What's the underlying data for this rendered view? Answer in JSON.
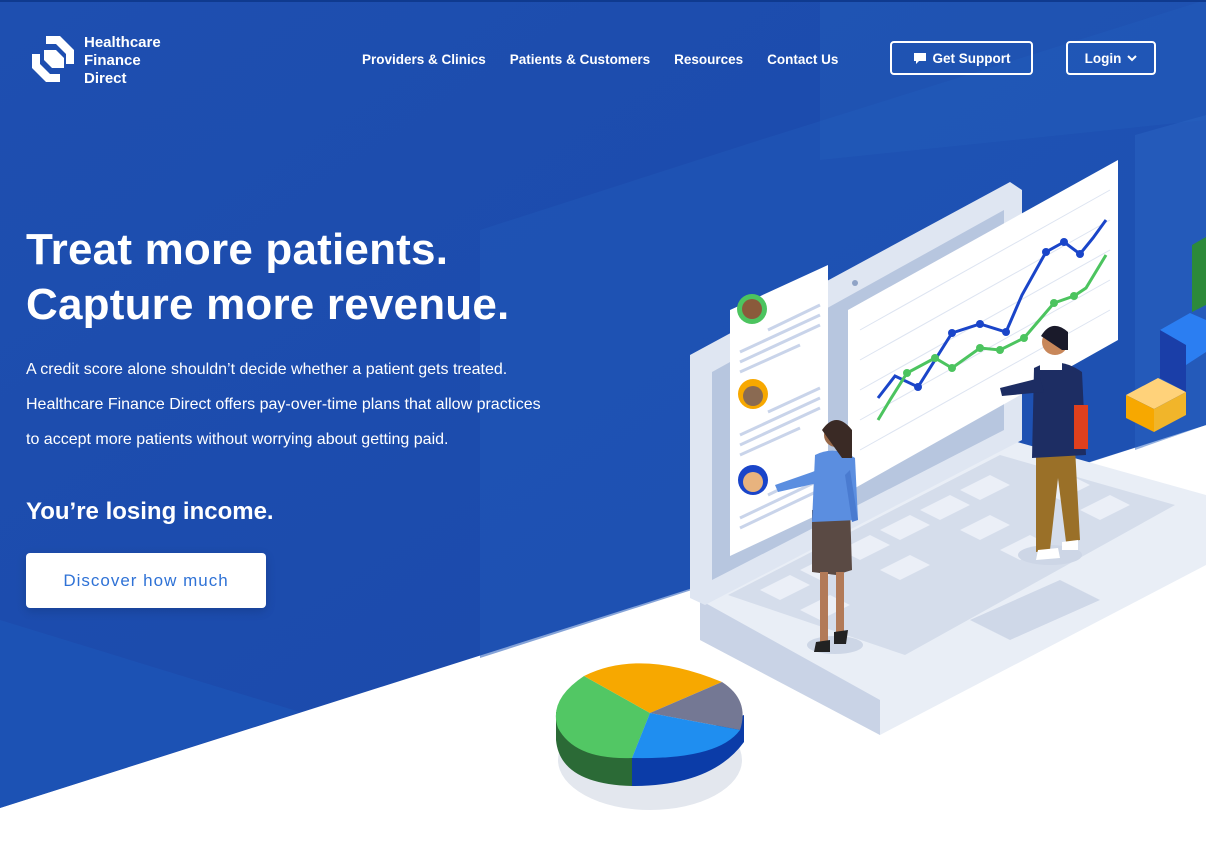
{
  "brand": {
    "name_line1": "Healthcare",
    "name_line2": "Finance",
    "name_line3": "Direct",
    "logo_icon": "hfd-logo-mark"
  },
  "nav": {
    "items": [
      {
        "label": "Providers & Clinics"
      },
      {
        "label": "Patients & Customers"
      },
      {
        "label": "Resources"
      },
      {
        "label": "Contact Us"
      }
    ],
    "support_label": "Get Support",
    "support_icon": "chat-bubble-icon",
    "login_label": "Login",
    "login_icon": "chevron-down-icon"
  },
  "hero": {
    "headline_line1": "Treat more patients.",
    "headline_line2": "Capture more revenue.",
    "desc_line1": "A credit score alone shouldn’t decide whether a patient gets treated.",
    "desc_line2": "Healthcare Finance Direct offers pay-over-time plans that allow practices",
    "desc_line3": "to accept more patients without worrying about getting paid.",
    "subheading": "You’re losing income.",
    "cta_label": "Discover how much"
  },
  "colors": {
    "primary_blue": "#1f52b3",
    "deep_blue": "#1b47a8",
    "cta_text": "#2f72d6",
    "chart_blue": "#1a45c9",
    "chart_green": "#4cc45f",
    "pie_orange": "#f7a800",
    "pie_gray": "#6f7390"
  }
}
